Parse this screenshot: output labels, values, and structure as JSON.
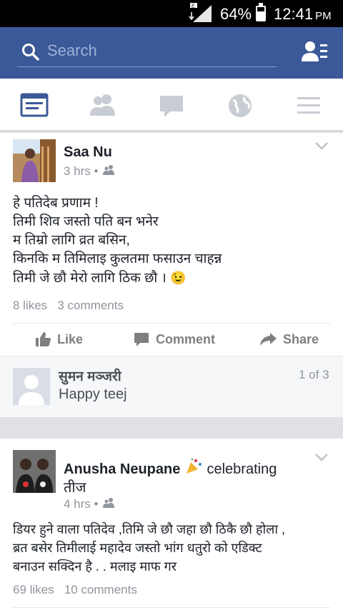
{
  "status_bar": {
    "battery": "64%",
    "battery_level": 0.64,
    "time": "12:41",
    "ampm": "PM"
  },
  "header": {
    "search_placeholder": "Search",
    "icons": {
      "search": "search-icon",
      "friends": "friend-requests-icon"
    }
  },
  "tabs": [
    {
      "name": "news-feed",
      "icon": "news-feed-icon",
      "active": true
    },
    {
      "name": "friends",
      "icon": "friends-icon",
      "active": false
    },
    {
      "name": "messages",
      "icon": "messages-icon",
      "active": false
    },
    {
      "name": "notifications",
      "icon": "globe-icon",
      "active": false
    },
    {
      "name": "menu",
      "icon": "menu-icon",
      "active": false
    }
  ],
  "post1": {
    "author": "Saa Nu",
    "time": "3 hrs •",
    "privacy_icon": "friends-privacy-icon",
    "lines": [
      "हे पतिदेब प्रणाम !",
      "तिमी शिव जस्तो पति बन भनेर",
      "म तिम्रो लागि व्रत बसिन,",
      "किनकि म तिमिलाइ कुलतमा फसाउन चाहन्न",
      "तिमी जे छौ मेरो लागि ठिक छौ ।"
    ],
    "emoji": "😉",
    "likes": "8 likes",
    "comments": "3 comments",
    "actions": {
      "like": "Like",
      "comment": "Comment",
      "share": "Share"
    }
  },
  "comment": {
    "author": "सुमन मञ्जरी",
    "text": "Happy teej",
    "pager": "1 of 3"
  },
  "post2": {
    "author": "Anusha Neupane",
    "activity": "celebrating",
    "activity_target": "तीज",
    "time": "4 hrs •",
    "lines": [
      "डियर हुने वाला पतिदेव ,तिमि जे छौ जहा छौ ठिकै छौ होला ,",
      "ब्रत बसेर तिमीलाई महादेव जस्तो भांग धतुरो को एडिक्ट",
      "बनाउन सक्दिन है . . मलाइ माफ गर"
    ],
    "likes": "69 likes",
    "comments": "10 comments"
  },
  "colors": {
    "brand": "#3b5998",
    "text": "#1d2129",
    "muted": "#90949c"
  }
}
